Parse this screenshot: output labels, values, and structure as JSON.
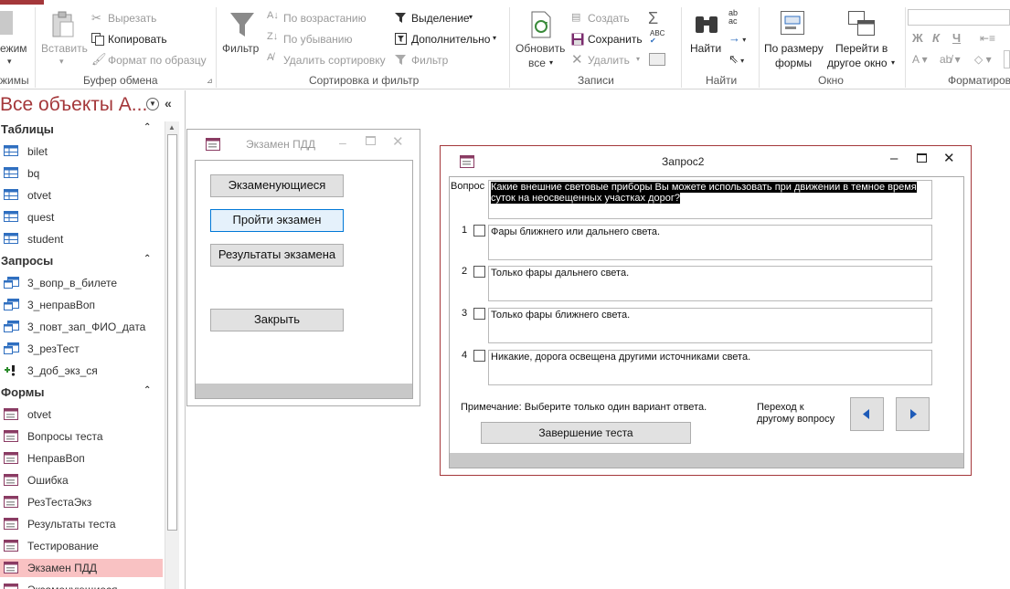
{
  "ribbon": {
    "view_label": "ежим",
    "view_sub": "жимы",
    "paste_label": "Вставить",
    "cut_label": "Вырезать",
    "copy_label": "Копировать",
    "format_painter_label": "Формат по образцу",
    "clipboard_group": "Буфер обмена",
    "filter_label": "Фильтр",
    "asc_label": "По возрастанию",
    "desc_label": "По убыванию",
    "remove_sort_label": "Удалить сортировку",
    "selection_label": "Выделение",
    "advanced_label": "Дополнительно",
    "toggle_filter_label": "Фильтр",
    "sort_group": "Сортировка и фильтр",
    "refresh_label_1": "Обновить",
    "refresh_label_2": "все",
    "new_label": "Создать",
    "save_label": "Сохранить",
    "delete_label": "Удалить",
    "records_group": "Записи",
    "find_label": "Найти",
    "find_group": "Найти",
    "fit_label_1": "По размеру",
    "fit_label_2": "формы",
    "switch_label_1": "Перейти в",
    "switch_label_2": "другое окно",
    "window_group": "Окно",
    "bold": "Ж",
    "italic": "К",
    "underline": "Ч",
    "format_group": "Форматиров"
  },
  "nav": {
    "title": "Все объекты A...",
    "sections": {
      "tables": "Таблицы",
      "queries": "Запросы",
      "forms": "Формы"
    },
    "tables": [
      "bilet",
      "bq",
      "otvet",
      "quest",
      "student"
    ],
    "queries": [
      "3_вопр_в_билете",
      "3_неправВоп",
      "3_повт_зап_ФИО_дата",
      "3_резТест",
      "3_доб_экз_ся"
    ],
    "forms": [
      "otvet",
      "Вопросы теста",
      "НеправВоп",
      "Ошибка",
      "РезТестаЭкз",
      "Результаты теста",
      "Тестирование",
      "Экзамен ПДД",
      "Экзаменующиеся"
    ]
  },
  "exam_window": {
    "title": "Экзамен ПДД",
    "btn_examinees": "Экзаменующиеся",
    "btn_take_exam": "Пройти экзамен",
    "btn_results": "Результаты экзамена",
    "btn_close": "Закрыть"
  },
  "query_window": {
    "title": "Запрос2",
    "question_label": "Вопрос",
    "question_text": "Какие внешние световые приборы Вы можете использовать при движении в темное время суток на неосвещенных участках дорог?",
    "answers": [
      {
        "num": "1",
        "text": "Фары ближнего или дальнего света."
      },
      {
        "num": "2",
        "text": "Только фары дальнего света."
      },
      {
        "num": "3",
        "text": "Только фары ближнего света."
      },
      {
        "num": "4",
        "text": "Никакие, дорога освещена другими источниками света."
      }
    ],
    "note": "Примечание: Выберите только один вариант ответа.",
    "nav_label_1": "Переход к",
    "nav_label_2": "другому вопросу",
    "finish_button": "Завершение теста"
  },
  "colors": {
    "accent": "#a4373a",
    "selected_item": "#f9c2c3",
    "nav_title": "#a4373a"
  }
}
